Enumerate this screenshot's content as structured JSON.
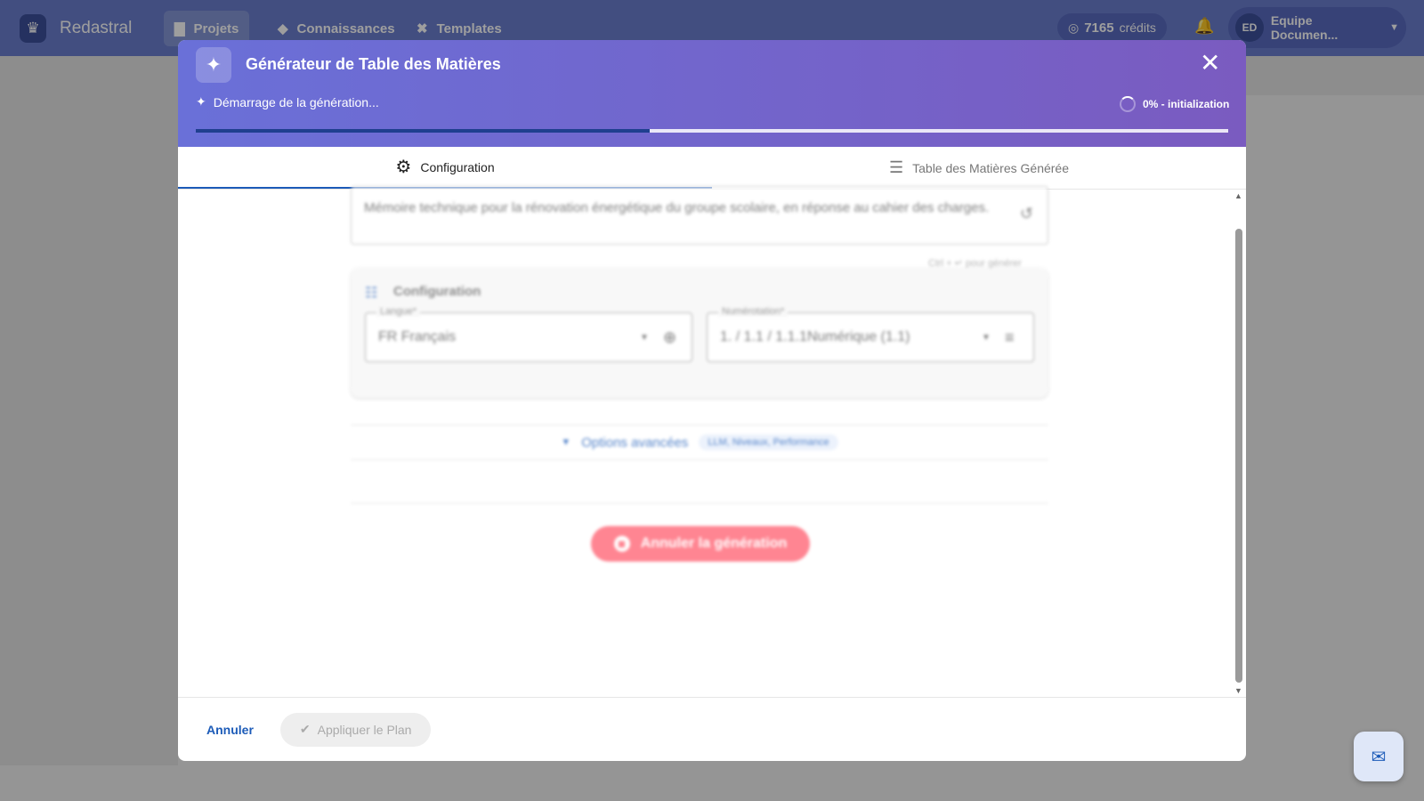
{
  "app": {
    "brand": "Redastral",
    "nav": [
      {
        "label": "Projets",
        "icon": "folder-icon"
      },
      {
        "label": "Connaissances",
        "icon": "graduation-cap-icon"
      },
      {
        "label": "Templates",
        "icon": "tools-icon"
      }
    ],
    "credits_value": "7165",
    "credits_label": "crédits",
    "user_initials": "ED",
    "user_name": "Equipe Documen..."
  },
  "modal": {
    "title": "Générateur de Table des Matières",
    "status_text": "Démarrage de la génération...",
    "progress_label": "0% - initialization",
    "progress_value": 0.44,
    "tabs": [
      "Configuration",
      "Table des Matières Générée"
    ],
    "active_tab": 0,
    "description": "Mémoire technique pour la rénovation énergétique du groupe scolaire, en réponse au cahier des charges.",
    "shortcut_hint": "Ctrl + ↵ pour générer",
    "config_title": "Configuration",
    "language_label": "Langue*",
    "language_value": "FR Français",
    "numbering_label": "Numérotation*",
    "numbering_value": "1. / 1.1 / 1.1.1Numérique (1.1)",
    "advanced_label": "Options avancées",
    "advanced_chip": "LLM, Niveaux, Performance",
    "cancel_generation": "Annuler la génération",
    "footer_cancel": "Annuler",
    "footer_apply": "Appliquer le Plan"
  },
  "colors": {
    "header_start": "#6a70d8",
    "header_end": "#7a5bc0",
    "accent": "#1c5bb8",
    "cancel_button": "#ff5d6e"
  }
}
